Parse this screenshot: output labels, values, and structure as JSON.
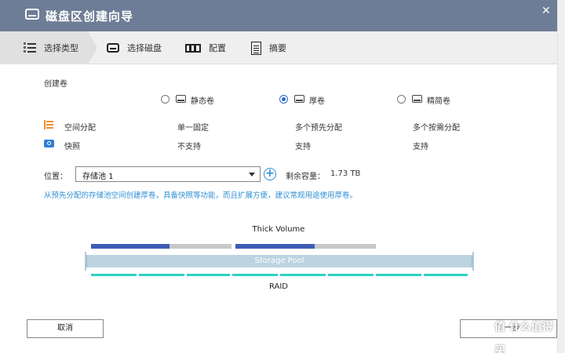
{
  "window": {
    "title": "磁盘区创建向导",
    "close_label": "✕"
  },
  "steps": [
    {
      "label": "选择类型",
      "icon": "list-icon",
      "active": true
    },
    {
      "label": "选择磁盘",
      "icon": "disk-icon",
      "active": false
    },
    {
      "label": "配置",
      "icon": "config-icon",
      "active": false
    },
    {
      "label": "摘要",
      "icon": "summary-icon",
      "active": false
    }
  ],
  "section_label": "创建卷",
  "volume_types": [
    {
      "label": "静态卷",
      "checked": false
    },
    {
      "label": "厚卷",
      "checked": true
    },
    {
      "label": "精简卷",
      "checked": false
    }
  ],
  "features": {
    "space_allocation": {
      "label": "空间分配",
      "values": [
        "单一固定",
        "多个预先分配",
        "多个按需分配"
      ]
    },
    "snapshot": {
      "label": "快照",
      "values": [
        "不支持",
        "支持",
        "支持"
      ]
    }
  },
  "location": {
    "label": "位置：",
    "selected": "存储池 1",
    "remaining_label": "剩余容量：",
    "remaining_value": "1.73 TB"
  },
  "hint": "从预先分配的存储池空间创建厚卷，具备快照等功能，而且扩展方便，建议常规用途使用厚卷。",
  "diagram": {
    "title": "Thick Volume",
    "pool_label": "Storage Pool",
    "raid_label": "RAID",
    "colors": {
      "used": "#3f5db6",
      "free": "#c8c8c8",
      "pool": "#bcd3e0",
      "raid": "#2fd2c0"
    }
  },
  "buttons": {
    "cancel": "取消",
    "next": "下一步"
  },
  "watermark": "值 什么值得买"
}
